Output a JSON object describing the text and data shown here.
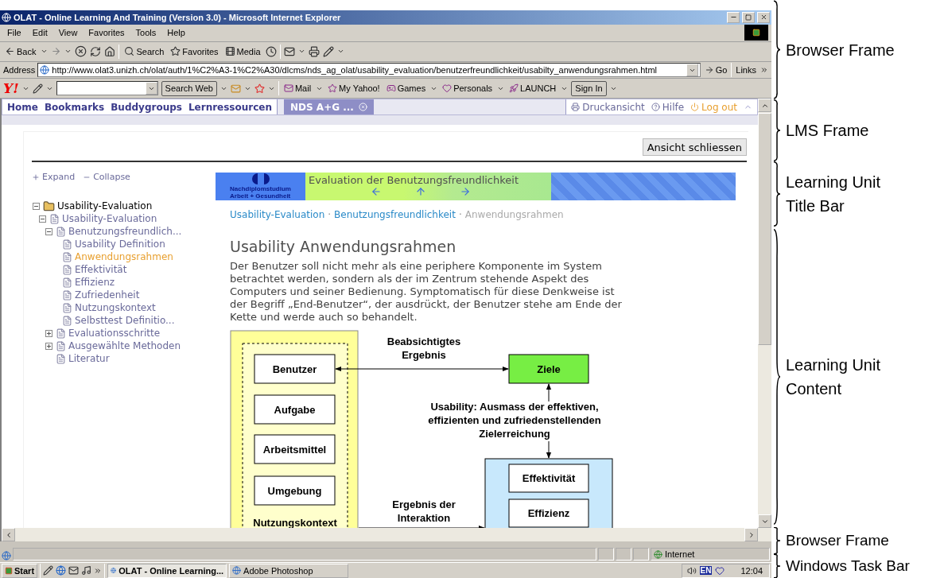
{
  "window": {
    "title": "OLAT - Online Learning And Training (Version 3.0) - Microsoft Internet Explorer"
  },
  "menu": [
    "File",
    "Edit",
    "View",
    "Favorites",
    "Tools",
    "Help"
  ],
  "toolbar": {
    "back": "Back",
    "search": "Search",
    "favorites": "Favorites",
    "media": "Media"
  },
  "address": {
    "label": "Address",
    "value": "http://www.olat3.unizh.ch/olat/auth/1%C2%A3-1%C2%A30/dlcms/nds_ag_olat/usability_evaluation/benutzerfreundlichkeit/usabilty_anwendungsrahmen.html",
    "go": "Go",
    "links": "Links"
  },
  "yahoo_bar": {
    "logo": "Y!",
    "search_button": "Search Web",
    "items": [
      "Mail",
      "My Yahoo!",
      "Games",
      "Personals",
      "LAUNCH"
    ],
    "sign_in": "Sign In"
  },
  "lms": {
    "nav": [
      "Home",
      "Bookmarks",
      "Buddygroups",
      "Lernressourcen"
    ],
    "tabs": [
      {
        "label": "NDS A+G ...",
        "selected": true
      }
    ],
    "tools": [
      {
        "label": "Druckansicht",
        "kind": "print"
      },
      {
        "label": "Hilfe",
        "kind": "help"
      },
      {
        "label": "Log out",
        "kind": "logout"
      }
    ],
    "close_view": "Ansicht schliessen"
  },
  "tree_controls": {
    "expand": "Expand",
    "collapse": "Collapse"
  },
  "tree": [
    {
      "label": "Usability-Evaluation",
      "kind": "folder",
      "expanded": true,
      "selected": false,
      "children": [
        {
          "label": "Usability-Evaluation",
          "kind": "page",
          "expanded": true,
          "selected": false,
          "children": [
            {
              "label": "Benutzungsfreundlich...",
              "kind": "page",
              "expanded": true,
              "selected": false,
              "children": [
                {
                  "label": "Usability Definition",
                  "kind": "page",
                  "selected": false
                },
                {
                  "label": "Anwendungsrahmen",
                  "kind": "page",
                  "selected": true
                },
                {
                  "label": "Effektivität",
                  "kind": "page",
                  "selected": false
                },
                {
                  "label": "Effizienz",
                  "kind": "page",
                  "selected": false
                },
                {
                  "label": "Zufriedenheit",
                  "kind": "page",
                  "selected": false
                },
                {
                  "label": "Nutzungskontext",
                  "kind": "page",
                  "selected": false
                },
                {
                  "label": "Selbsttest Definitio...",
                  "kind": "page",
                  "selected": false
                }
              ]
            },
            {
              "label": "Evaluationsschritte",
              "kind": "page",
              "expanded": false,
              "selected": false
            },
            {
              "label": "Ausgewählte Methoden",
              "kind": "page",
              "expanded": false,
              "selected": false
            },
            {
              "label": "Literatur",
              "kind": "page",
              "selected": false
            }
          ]
        }
      ]
    }
  ],
  "banner": {
    "logo_lines": [
      "Nachdiplomstudium",
      "Arbeit + Gesundheit"
    ],
    "title": "Evaluation der Benutzungsfreundlichkeit"
  },
  "breadcrumb": [
    {
      "label": "Usability-Evaluation",
      "selected": false,
      "separator": "·"
    },
    {
      "label": "Benutzungsfreundlichkeit",
      "selected": false,
      "separator": "·"
    },
    {
      "label": "Anwendungsrahmen",
      "selected": true
    }
  ],
  "heading": "Usability Anwendungsrahmen",
  "paragraph": "Der Benutzer soll nicht mehr als eine periphere Komponente im System betrachtet werden, sondern als der im Zentrum stehende Aspekt des Computers und seiner Bedienung. Symptomatisch für diese Denkweise ist der Begriff „End-Benutzer“, der ausdrückt, der Benutzer stehe am Ende der Kette und werde auch so behandelt.",
  "diagram": {
    "context_items": [
      "Benutzer",
      "Aufgabe",
      "Arbeitsmittel",
      "Umgebung"
    ],
    "context_label": "Nutzungskontext",
    "goal": "Ziele",
    "intended": [
      "Beabsichtigtes",
      "Ergebnis"
    ],
    "usability": [
      "Usability: Ausmass der effektiven,",
      "effizienten und zufriedenstellenden",
      "Zielerreichung"
    ],
    "interaction": [
      "Ergebnis der",
      "Interaktion"
    ],
    "measures": [
      "Effektivität",
      "Effizienz"
    ]
  },
  "status_bar": {
    "zone": "Internet"
  },
  "taskbar": {
    "start": "Start",
    "tasks": [
      {
        "label": "OLAT - Online Learning...",
        "selected": true
      },
      {
        "label": "Adobe Photoshop",
        "selected": false
      }
    ],
    "language": "EN",
    "clock": "12:04"
  },
  "annotations": [
    "Browser Frame",
    "LMS Frame",
    "Learning Unit Title Bar",
    "Learning Unit Content",
    "Browser Frame",
    "Windows Task Bar"
  ]
}
